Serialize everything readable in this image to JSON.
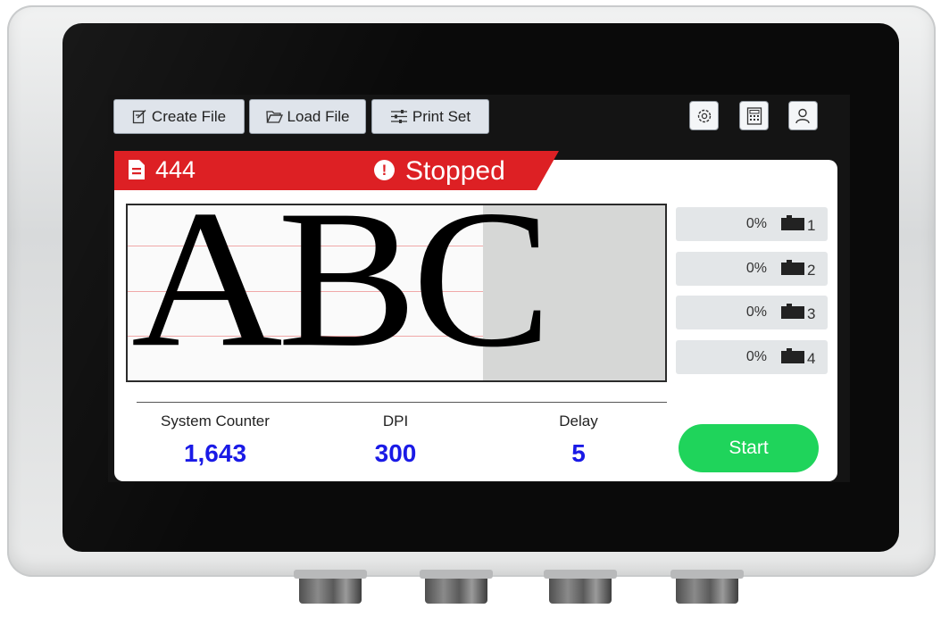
{
  "toolbar": {
    "create_file": "Create File",
    "load_file": "Load File",
    "print_set": "Print Set"
  },
  "toolbar_icons": [
    "settings-icon",
    "calculator-icon",
    "user-icon"
  ],
  "status": {
    "file_name": "444",
    "state": "Stopped",
    "bar_color": "#dd2024"
  },
  "preview": {
    "print_text": "ABC"
  },
  "ink_levels": [
    {
      "percent": "0%",
      "number": "1"
    },
    {
      "percent": "0%",
      "number": "2"
    },
    {
      "percent": "0%",
      "number": "3"
    },
    {
      "percent": "0%",
      "number": "4"
    }
  ],
  "stats": {
    "system_counter_label": "System Counter",
    "system_counter_value": "1,643",
    "dpi_label": "DPI",
    "dpi_value": "300",
    "delay_label": "Delay",
    "delay_value": "5"
  },
  "start_button": {
    "label": "Start",
    "color": "#1fd45b"
  },
  "value_color": "#1a1ae6"
}
